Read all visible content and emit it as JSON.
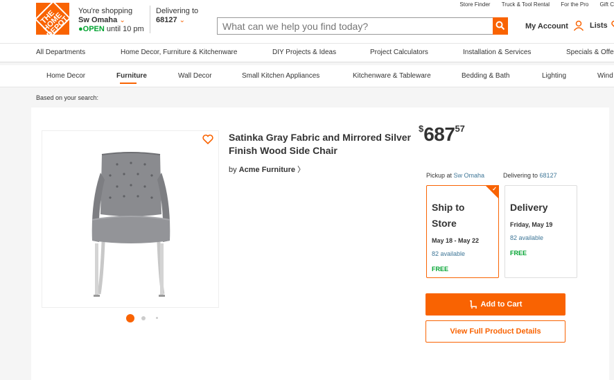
{
  "header": {
    "logo_text": "THE HOME DEPOT",
    "shopping_label": "You're shopping",
    "store_name": "Sw Omaha",
    "open_status": "OPEN",
    "open_until": "until 10 pm",
    "delivering_label": "Delivering to",
    "zip": "68127",
    "top_links": [
      "Store Finder",
      "Truck & Tool Rental",
      "For the Pro",
      "Gift C"
    ],
    "search_placeholder": "What can we help you find today?",
    "account_label": "My Account",
    "lists_label": "Lists"
  },
  "nav_departments": [
    "All Departments",
    "Home Decor, Furniture & Kitchenware",
    "DIY Projects & Ideas",
    "Project Calculators",
    "Installation & Services",
    "Specials & Offe"
  ],
  "nav_sub": [
    "Home Decor",
    "Furniture",
    "Wall Decor",
    "Small Kitchen Appliances",
    "Kitchenware & Tableware",
    "Bedding & Bath",
    "Lighting",
    "Wind"
  ],
  "based_on": "Based on your search:",
  "product": {
    "title": "Satinka Gray Fabric and Mirrored Silver Finish Wood Side Chair",
    "by_label": "by",
    "brand": "Acme Furniture",
    "price_currency": "$",
    "price_dollars": "687",
    "price_cents": "57"
  },
  "fulfillment": {
    "pickup_label": "Pickup at",
    "pickup_store": "Sw Omaha",
    "delivery_label": "Delivering to",
    "delivery_zip": "68127",
    "ship": {
      "line1": "Ship to",
      "line2": "Store",
      "date": "May 18 - May 22",
      "available": "82 available",
      "cost": "FREE"
    },
    "delivery": {
      "line1": "Delivery",
      "date": "Friday, May 19",
      "available": "82 available",
      "cost": "FREE"
    }
  },
  "buttons": {
    "add_to_cart": "Add to Cart",
    "view_details": "View Full Product Details"
  },
  "colors": {
    "brand_orange": "#f96302",
    "in_stock_green": "#00a330",
    "link_blue": "#3e7697"
  }
}
